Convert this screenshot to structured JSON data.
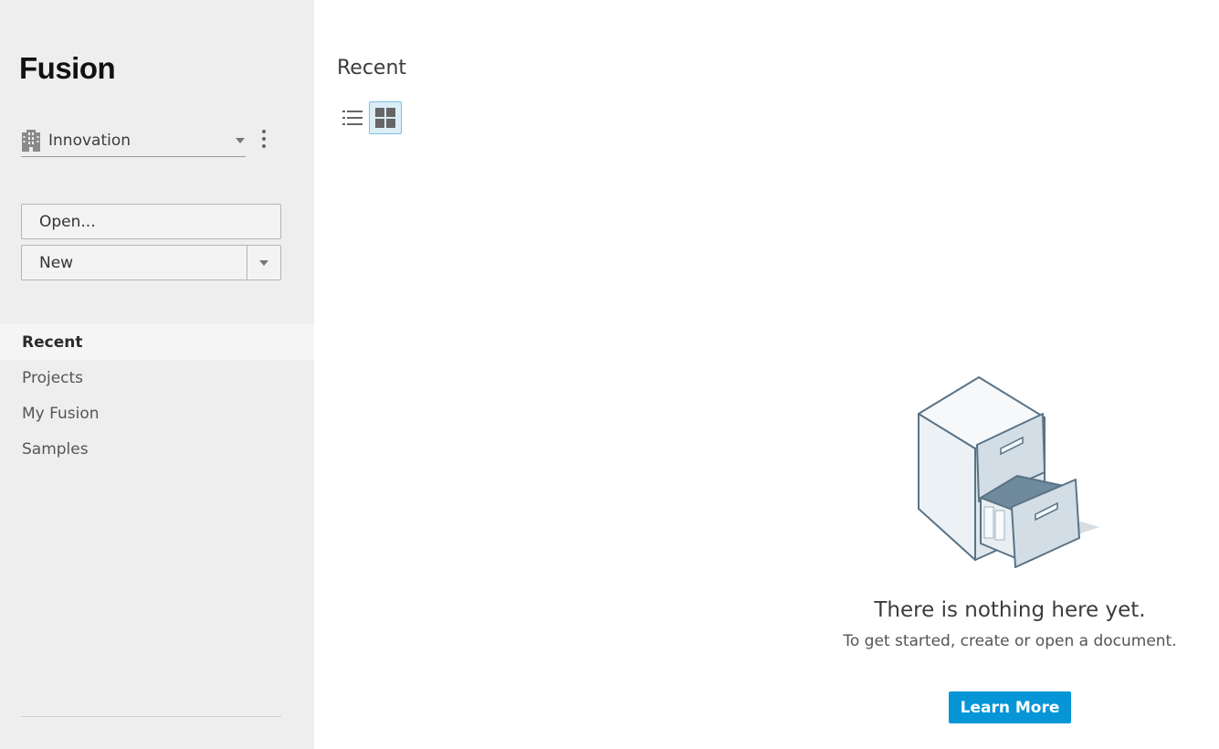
{
  "app": {
    "brand": "Fusion"
  },
  "team": {
    "name": "Innovation",
    "icon": "building-icon"
  },
  "buttons": {
    "open_label": "Open...",
    "new_label": "New"
  },
  "nav": {
    "items": [
      {
        "label": "Recent",
        "active": true
      },
      {
        "label": "Projects",
        "active": false
      },
      {
        "label": "My Fusion",
        "active": false
      },
      {
        "label": "Samples",
        "active": false
      }
    ]
  },
  "main": {
    "title": "Recent",
    "view_modes": [
      {
        "name": "list-view-icon",
        "selected": false
      },
      {
        "name": "grid-view-icon",
        "selected": true
      }
    ],
    "empty_state": {
      "title": "There is nothing here yet.",
      "subtitle": "To get started, create or open a document.",
      "button_label": "Learn More",
      "illustration": "file-cabinet-icon"
    }
  },
  "colors": {
    "sidebar_bg": "#eeeeee",
    "accent": "#0696d7",
    "selected_view_bg": "#dbeef7",
    "selected_view_border": "#7cc0e2"
  }
}
